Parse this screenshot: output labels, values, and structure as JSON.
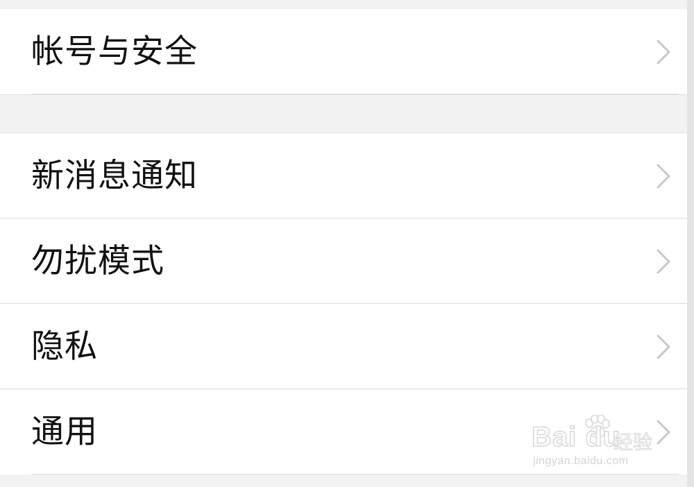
{
  "settings": {
    "group1": [
      {
        "label": "帐号与安全",
        "icon": "chevron-right-icon"
      }
    ],
    "group2": [
      {
        "label": "新消息通知",
        "icon": "chevron-right-icon"
      },
      {
        "label": "勿扰模式",
        "icon": "chevron-right-icon"
      },
      {
        "label": "隐私",
        "icon": "chevron-right-icon"
      },
      {
        "label": "通用",
        "icon": "chevron-right-icon"
      }
    ]
  },
  "watermark": {
    "brand": "Bai du",
    "brand_cn": "经验",
    "site": "jingyan.baidu.com"
  },
  "colors": {
    "background": "#f2f2f2",
    "row_background": "#ffffff",
    "divider": "#dcdcdc",
    "chevron": "#c7c7cc",
    "text": "#111111"
  }
}
